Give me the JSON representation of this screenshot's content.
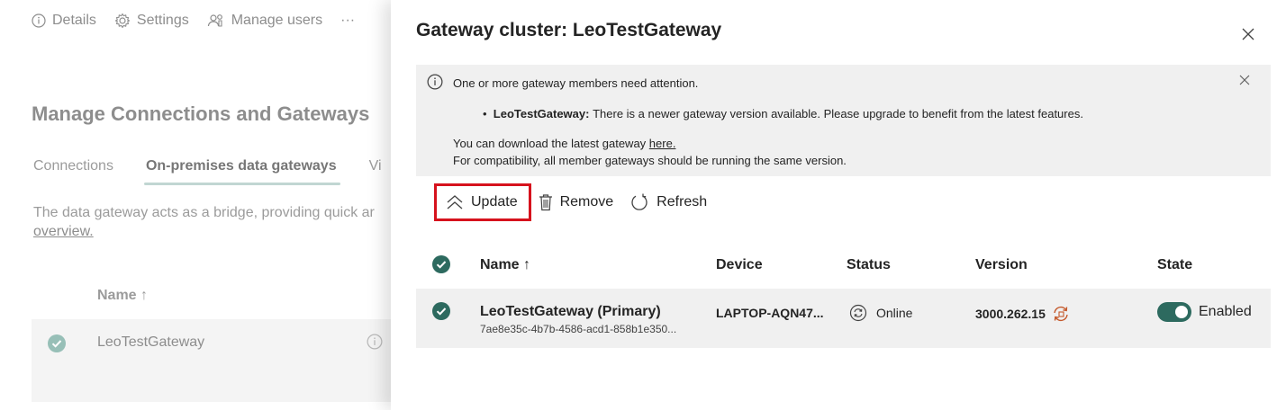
{
  "background": {
    "toolbar": {
      "details": "Details",
      "settings": "Settings",
      "manage_users": "Manage users",
      "more": "···"
    },
    "title": "Manage Connections and Gateways",
    "tabs": [
      "Connections",
      "On-premises data gateways",
      "Vi"
    ],
    "description_line1": "The data gateway acts as a bridge, providing quick ar",
    "description_link": "overview.",
    "table_header_name": "Name ↑",
    "row_name": "LeoTestGateway"
  },
  "panel": {
    "title": "Gateway cluster: LeoTestGateway",
    "alert": {
      "message": "One or more gateway members need attention.",
      "bullet_name": "LeoTestGateway:",
      "bullet_text": "There is a newer gateway version available. Please upgrade to benefit from the latest features.",
      "download_prefix": "You can download the latest gateway ",
      "download_link": "here.",
      "compat": "For compatibility, all member gateways should be running the same version."
    },
    "toolbar": {
      "update": "Update",
      "remove": "Remove",
      "refresh": "Refresh"
    },
    "columns": {
      "name": "Name ↑",
      "device": "Device",
      "status": "Status",
      "version": "Version",
      "state": "State"
    },
    "row": {
      "name": "LeoTestGateway (Primary)",
      "id": "7ae8e35c-4b7b-4586-acd1-858b1e350...",
      "device": "LAPTOP-AQN47...",
      "status": "Online",
      "version": "3000.262.15",
      "state": "Enabled"
    }
  },
  "colors": {
    "accent": "#2d6a5f",
    "highlight": "#d6121d",
    "warning": "#c4582a"
  }
}
